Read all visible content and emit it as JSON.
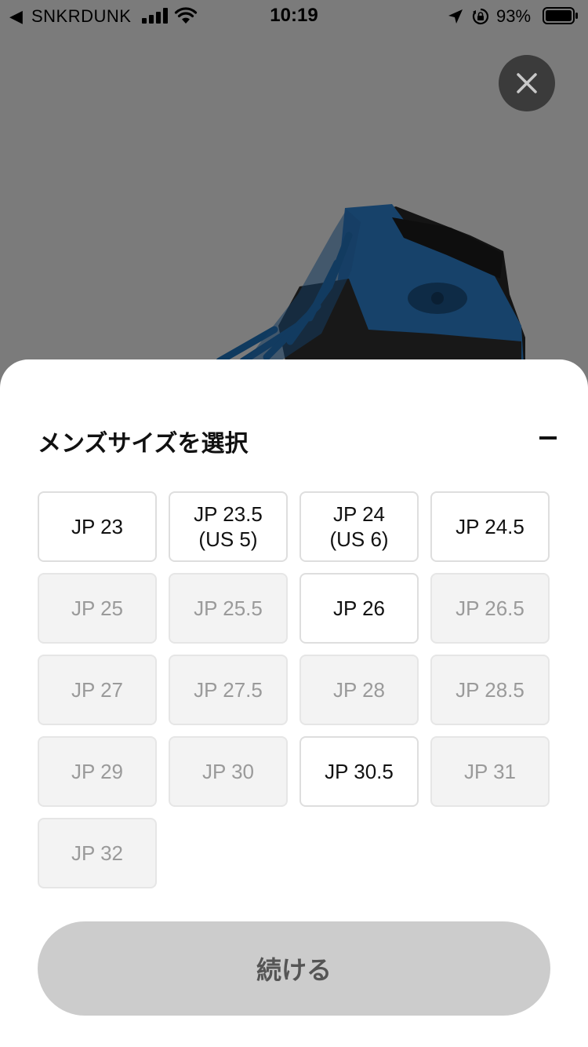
{
  "status_bar": {
    "back_arrow": "◀",
    "app_name": "SNKRDUNK",
    "time": "10:19",
    "battery_percent": "93%",
    "icons": [
      "signal-icon",
      "wifi-icon",
      "location-icon",
      "rotation-lock-icon",
      "battery-icon"
    ]
  },
  "overlay": {
    "close_icon": "close-icon",
    "product_image": "navy-black-high-top-sneaker"
  },
  "size_sheet": {
    "title": "メンズサイズを選択",
    "collapse_icon": "minus-icon",
    "sizes": [
      {
        "label": "JP 23",
        "available": true
      },
      {
        "label": "JP 23.5\n(US 5)",
        "available": true
      },
      {
        "label": "JP 24\n(US 6)",
        "available": true
      },
      {
        "label": "JP 24.5",
        "available": true
      },
      {
        "label": "JP 25",
        "available": false
      },
      {
        "label": "JP 25.5",
        "available": false
      },
      {
        "label": "JP 26",
        "available": true
      },
      {
        "label": "JP 26.5",
        "available": false
      },
      {
        "label": "JP 27",
        "available": false
      },
      {
        "label": "JP 27.5",
        "available": false
      },
      {
        "label": "JP 28",
        "available": false
      },
      {
        "label": "JP 28.5",
        "available": false
      },
      {
        "label": "JP 29",
        "available": false
      },
      {
        "label": "JP 30",
        "available": false
      },
      {
        "label": "JP 30.5",
        "available": true
      },
      {
        "label": "JP 31",
        "available": false
      },
      {
        "label": "JP 32",
        "available": false
      }
    ],
    "continue_label": "続ける"
  },
  "colors": {
    "backdrop": "#7b7b7b",
    "close_button": "#3b3b3b",
    "available_bg": "#ffffff",
    "unavailable_bg": "#f3f3f3",
    "continue_bg": "#cccccc"
  }
}
